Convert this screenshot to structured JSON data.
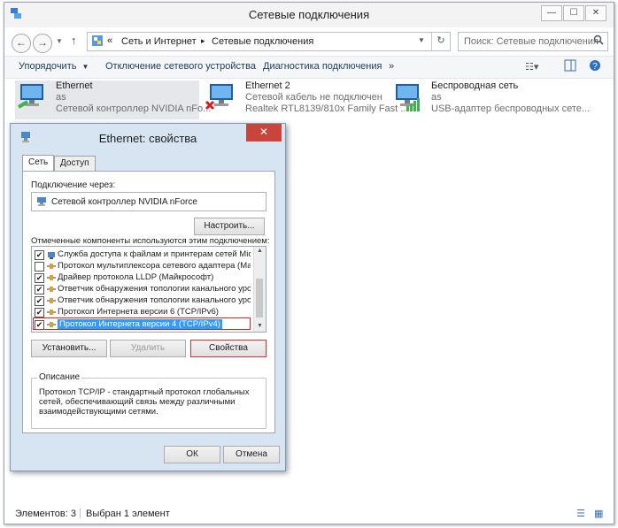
{
  "window": {
    "title": "Сетевые подключения",
    "min_label": "—",
    "max_label": "☐",
    "close_label": "✕"
  },
  "address": {
    "breadcrumb_prefix": "«",
    "crumb1": "Сеть и Интернет",
    "separator": "▸",
    "crumb2": "Сетевые подключения",
    "search_placeholder": "Поиск: Сетевые подключения"
  },
  "toolbar": {
    "organize": "Упорядочить",
    "disable": "Отключение сетевого устройства",
    "diagnose": "Диагностика подключения",
    "more": "»"
  },
  "connections": [
    {
      "name": "Ethernet",
      "line2": "as",
      "line3": "Сетевой контроллер NVIDIA nFo..."
    },
    {
      "name": "Ethernet 2",
      "line2": "Сетевой кабель не подключен",
      "line3": "Realtek RTL8139/810x Family Fast ..."
    },
    {
      "name": "Беспроводная сеть",
      "line2": "as",
      "line3": "USB-адаптер беспроводных сете..."
    }
  ],
  "dialog": {
    "title": "Ethernet: свойства",
    "close_label": "✕",
    "tabs": [
      "Сеть",
      "Доступ"
    ],
    "connect_via_label": "Подключение через:",
    "adapter": "Сетевой контроллер NVIDIA nForce",
    "configure": "Настроить...",
    "components_label": "Отмеченные компоненты используются этим подключением:",
    "components": [
      {
        "label": "Служба доступа к файлам и принтерам сетей Micro",
        "checked": "✔"
      },
      {
        "label": "Протокол мультиплексора сетевого адаптера (Май",
        "checked": ""
      },
      {
        "label": "Драйвер протокола LLDP (Майкрософт)",
        "checked": "✔"
      },
      {
        "label": "Ответчик обнаружения топологии канального урове",
        "checked": "✔"
      },
      {
        "label": "Ответчик обнаружения топологии канального урове",
        "checked": "✔"
      },
      {
        "label": "Протокол Интернета версии 6 (TCP/IPv6)",
        "checked": "✔"
      },
      {
        "label": "Протокол Интернета версии 4 (TCP/IPv4)",
        "checked": "✔"
      }
    ],
    "install": "Установить...",
    "remove": "Удалить",
    "properties": "Свойства",
    "description_label": "Описание",
    "description": "Протокол TCP/IP - стандартный протокол глобальных сетей, обеспечивающий связь между различными взаимодействующими сетями.",
    "ok": "ОК",
    "cancel": "Отмена"
  },
  "status": {
    "items": "Элементов: 3",
    "selected": "Выбран 1 элемент"
  },
  "colors": {
    "accent": "#3399ff",
    "highlight_border": "#e02020",
    "dialog_frame": "#d7e4f2",
    "close_red": "#c7453a"
  }
}
